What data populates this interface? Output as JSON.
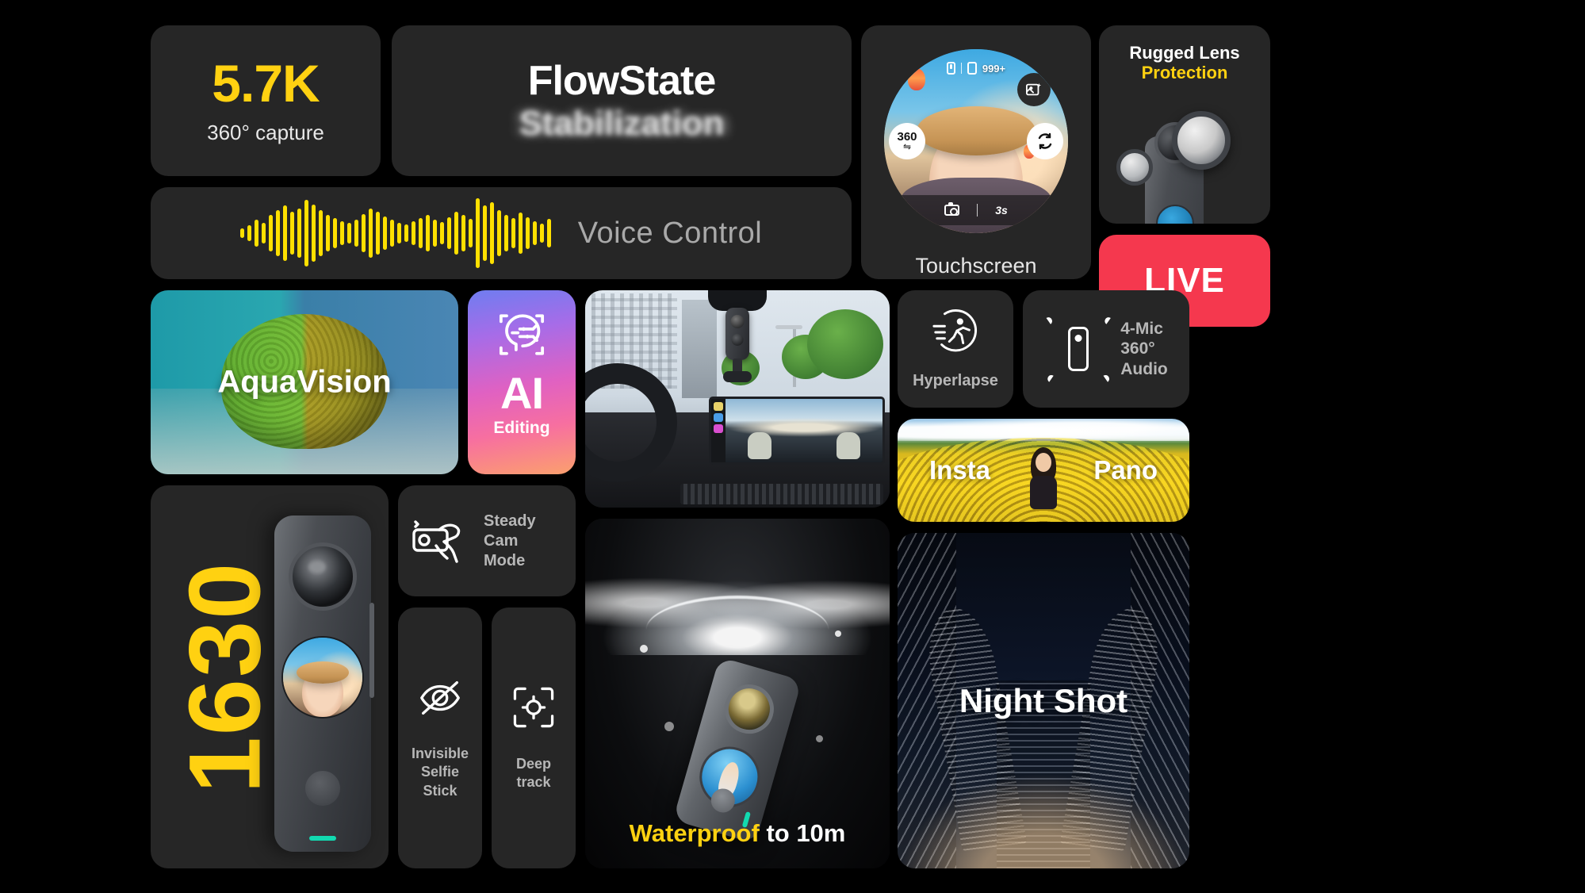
{
  "cards": {
    "resolution": {
      "value": "5.7K",
      "caption": "360° capture"
    },
    "flowstate": {
      "line1": "FlowState",
      "line2": "Stabilization"
    },
    "touchscreen": {
      "label": "Touchscreen",
      "photo_count": "999+",
      "mode_badge": "360",
      "timer": "3s",
      "icons": [
        "battery-icon",
        "sd-card-icon",
        "gallery-icon",
        "flip-camera-icon",
        "shutter-icon",
        "360-mode-icon"
      ]
    },
    "rugged_lens": {
      "line1": "Rugged Lens",
      "line2": "Protection"
    },
    "voice_control": {
      "label": "Voice Control",
      "waveform": [
        12,
        20,
        34,
        26,
        46,
        58,
        70,
        54,
        62,
        84,
        72,
        58,
        46,
        38,
        30,
        26,
        34,
        48,
        62,
        54,
        42,
        34,
        26,
        22,
        30,
        38,
        46,
        34,
        28,
        40,
        54,
        46,
        36,
        88,
        70,
        78,
        58,
        46,
        38,
        52,
        40,
        30,
        24,
        36
      ]
    },
    "live": {
      "label": "LIVE",
      "color": "#F5384E"
    },
    "aquavision": {
      "label": "AquaVision"
    },
    "ai_editing": {
      "line1": "AI",
      "line2": "Editing"
    },
    "dashcam": {
      "label": ""
    },
    "hyperlapse": {
      "label": "Hyperlapse",
      "icon": "running-person-icon"
    },
    "mic_audio": {
      "line1": "4-Mic",
      "line2": "360°",
      "line3": "Audio",
      "icon": "camera-sound-waves-icon"
    },
    "insta_pano": {
      "left": "Insta",
      "right": "Pano"
    },
    "camera_1630": {
      "number": "1630"
    },
    "steady_cam": {
      "line1": "Steady",
      "line2": "Cam",
      "line3": "Mode",
      "icon": "hand-holding-camera-icon"
    },
    "invisible_selfie": {
      "line1": "Invisible",
      "line2": "Selfie",
      "line3": "Stick",
      "icon": "eye-slash-icon"
    },
    "deep_track": {
      "line1": "Deep",
      "line2": "track",
      "icon": "focus-target-icon"
    },
    "waterproof": {
      "highlight": "Waterproof",
      "rest": " to 10m"
    },
    "night_shot": {
      "label": "Night Shot"
    }
  },
  "theme": {
    "background": "#000000",
    "card_background": "#262626",
    "accent_yellow": "#FFD111",
    "accent_red": "#F5384E",
    "text_grey": "#B7B7B7"
  }
}
